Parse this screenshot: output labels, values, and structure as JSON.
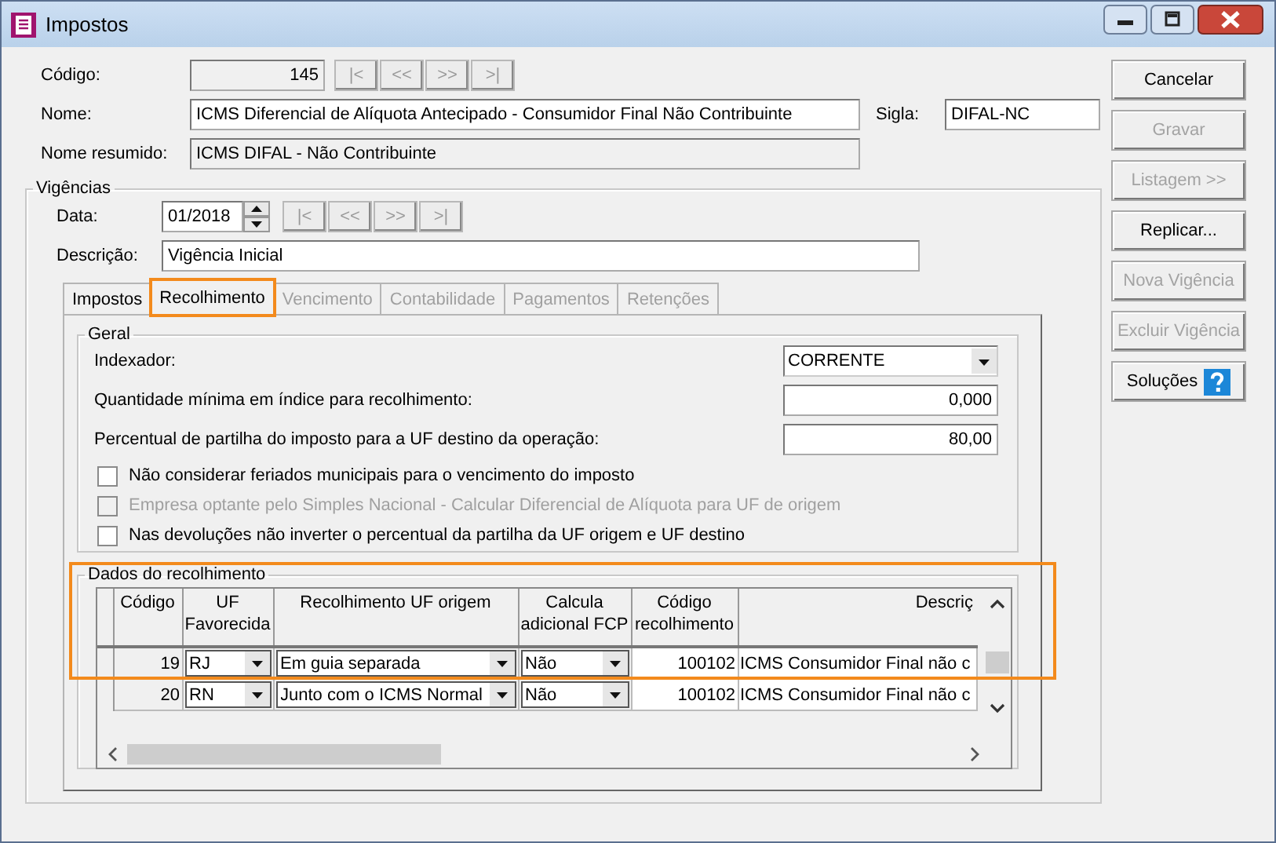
{
  "window": {
    "title": "Impostos"
  },
  "form": {
    "codigo": {
      "label": "Código:",
      "value": "145"
    },
    "nome": {
      "label": "Nome:",
      "value": "ICMS Diferencial de Alíquota Antecipado - Consumidor Final Não Contribuinte"
    },
    "sigla": {
      "label": "Sigla:",
      "value": "DIFAL-NC"
    },
    "nome_resumido": {
      "label": "Nome resumido:",
      "value": "ICMS DIFAL - Não Contribuinte"
    }
  },
  "record_nav": [
    "|<",
    "<<",
    ">>",
    ">|"
  ],
  "vigencias": {
    "title": "Vigências",
    "data": {
      "label": "Data:",
      "value": "01/2018"
    },
    "nav": [
      "|<",
      "<<",
      ">>",
      ">|"
    ],
    "descricao": {
      "label": "Descrição:",
      "value": "Vigência Inicial"
    },
    "tabs": [
      {
        "label": "Impostos",
        "selected": false,
        "disabled": false,
        "highlighted": false
      },
      {
        "label": "Recolhimento",
        "selected": true,
        "disabled": false,
        "highlighted": true
      },
      {
        "label": "Vencimento",
        "selected": false,
        "disabled": true,
        "highlighted": false
      },
      {
        "label": "Contabilidade",
        "selected": false,
        "disabled": true,
        "highlighted": false
      },
      {
        "label": "Pagamentos",
        "selected": false,
        "disabled": true,
        "highlighted": false
      },
      {
        "label": "Retenções",
        "selected": false,
        "disabled": true,
        "highlighted": false
      }
    ],
    "geral": {
      "title": "Geral",
      "indexador": {
        "label": "Indexador:",
        "value": "CORRENTE"
      },
      "quantidade": {
        "label": "Quantidade mínima em índice para recolhimento:",
        "value": "0,000"
      },
      "percentual": {
        "label": "Percentual de partilha do imposto para a UF destino da operação:",
        "value": "80,00"
      },
      "checkboxes": [
        {
          "label": "Não considerar feriados municipais para o vencimento do imposto",
          "checked": false,
          "disabled": false
        },
        {
          "label": "Empresa optante pelo Simples Nacional - Calcular Diferencial de Alíquota para UF de origem",
          "checked": false,
          "disabled": true
        },
        {
          "label": "Nas devoluções não inverter o percentual da partilha da UF origem e UF destino",
          "checked": false,
          "disabled": false
        }
      ]
    },
    "dados": {
      "title": "Dados do recolhimento",
      "highlighted": true,
      "columns": [
        "Código",
        "UF Favorecida",
        "Recolhimento UF origem",
        "Calcula adicional FCP",
        "Código recolhimento",
        "Descriç"
      ],
      "rows": [
        {
          "codigo": "19",
          "uf": "RJ",
          "recolhimento": "Em guia separada",
          "fcp": "Não",
          "codigo_recolhimento": "100102",
          "descricao": "ICMS Consumidor Final não c"
        },
        {
          "codigo": "20",
          "uf": "RN",
          "recolhimento": "Junto com o ICMS Normal",
          "fcp": "Não",
          "codigo_recolhimento": "100102",
          "descricao": "ICMS Consumidor Final não c"
        }
      ]
    }
  },
  "buttons": [
    {
      "label": "Cancelar",
      "disabled": false,
      "kind": "plain"
    },
    {
      "label": "Gravar",
      "disabled": true,
      "kind": "plain"
    },
    {
      "label": "Listagem >>",
      "disabled": true,
      "kind": "plain"
    },
    {
      "label": "Replicar...",
      "disabled": false,
      "kind": "plain"
    },
    {
      "label": "Nova Vigência",
      "disabled": true,
      "kind": "plain"
    },
    {
      "label": "Excluir Vigência",
      "disabled": true,
      "kind": "plain"
    },
    {
      "label": "Soluções",
      "disabled": false,
      "kind": "help"
    }
  ]
}
